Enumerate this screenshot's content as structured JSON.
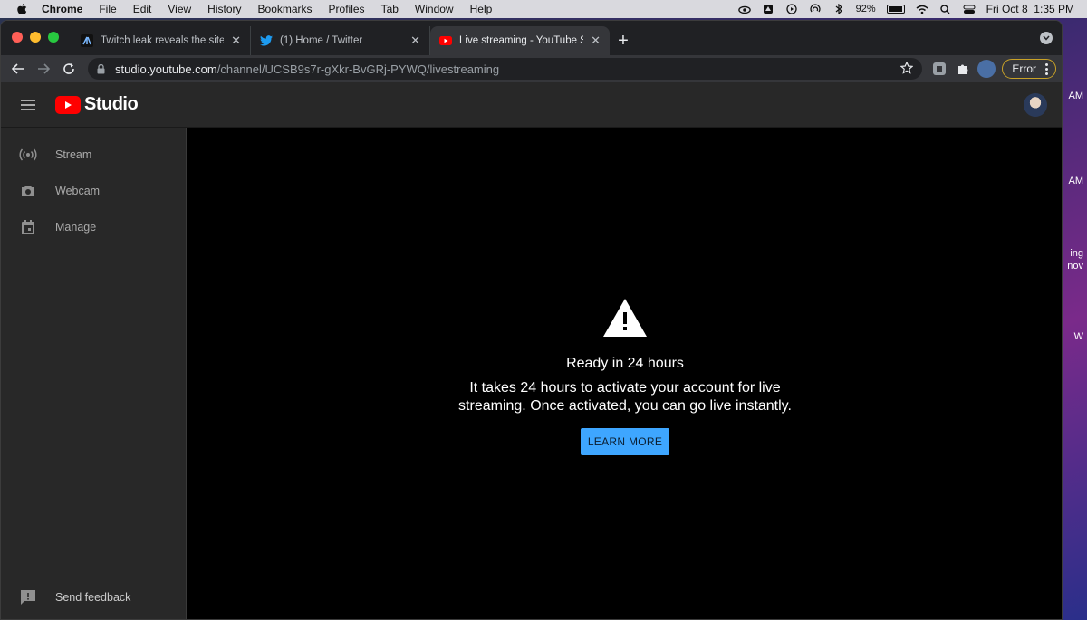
{
  "menubar": {
    "app": "Chrome",
    "items": [
      "File",
      "Edit",
      "View",
      "History",
      "Bookmarks",
      "Profiles",
      "Tab",
      "Window",
      "Help"
    ],
    "battery": "92%",
    "datetime": "Fri Oct 8  1:35 PM"
  },
  "desktop_fragments": [
    "AM",
    "AM",
    "ing",
    "nov",
    "W"
  ],
  "browser": {
    "tabs": [
      {
        "title": "Twitch leak reveals the site's h",
        "icon": "twitch-news-favicon"
      },
      {
        "title": "(1) Home / Twitter",
        "icon": "twitter-favicon"
      },
      {
        "title": "Live streaming - YouTube Studi",
        "icon": "youtube-favicon",
        "active": true
      }
    ],
    "url_host": "studio.youtube.com",
    "url_path": "/channel/UCSB9s7r-gXkr-BvGRj-PYWQ/livestreaming",
    "error_label": "Error"
  },
  "studio": {
    "logo_text": "Studio",
    "nav": [
      {
        "label": "Stream",
        "icon": "broadcast-icon"
      },
      {
        "label": "Webcam",
        "icon": "camera-icon"
      },
      {
        "label": "Manage",
        "icon": "calendar-icon"
      }
    ],
    "feedback_label": "Send feedback",
    "notice": {
      "title": "Ready in 24 hours",
      "body": "It takes 24 hours to activate your account for live streaming. Once activated, you can go live instantly.",
      "button": "LEARN MORE"
    }
  },
  "colors": {
    "accent_blue": "#3ea6ff",
    "youtube_red": "#ff0000",
    "sidebar_bg": "#282828",
    "error_outline": "#c9a227"
  }
}
